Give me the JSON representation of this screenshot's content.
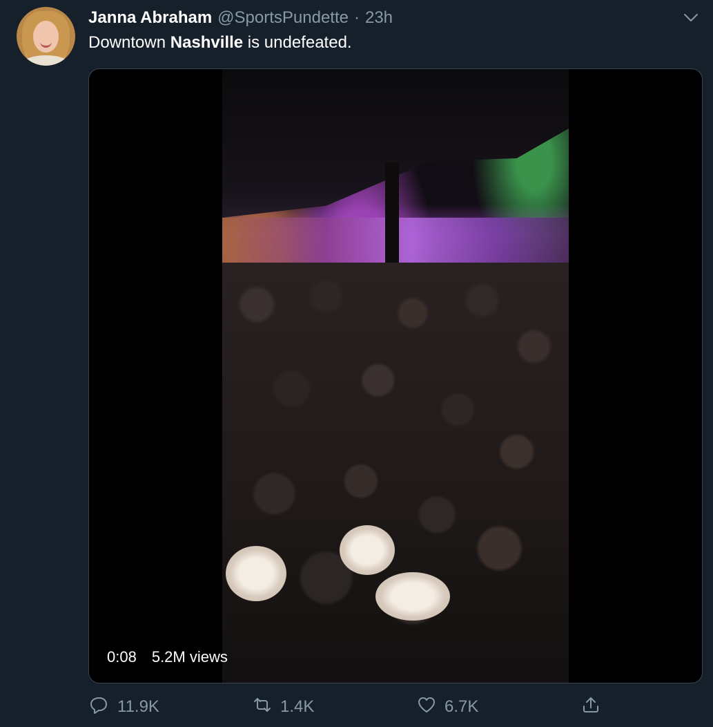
{
  "tweet": {
    "author_name": "Janna Abraham",
    "author_handle": "@SportsPundette",
    "separator": "·",
    "timestamp": "23h",
    "text_before": "Downtown ",
    "text_bold": "Nashville",
    "text_after": " is undefeated."
  },
  "media": {
    "duration": "0:08",
    "views": "5.2M views"
  },
  "actions": {
    "reply_count": "11.9K",
    "retweet_count": "1.4K",
    "like_count": "6.7K"
  },
  "icons": {
    "menu": "chevron-down-icon",
    "reply": "reply-icon",
    "retweet": "retweet-icon",
    "like": "heart-icon",
    "share": "share-icon"
  },
  "colors": {
    "background": "#15202b",
    "secondary_text": "#8899a6",
    "border": "#38444d"
  }
}
